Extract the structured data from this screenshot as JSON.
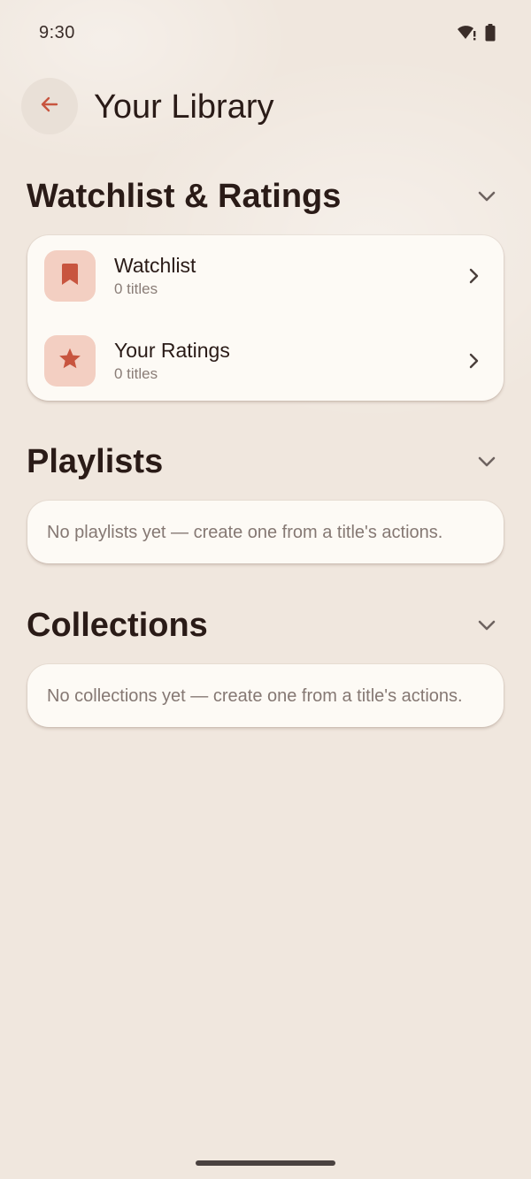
{
  "status_bar": {
    "time": "9:30",
    "icons": [
      "wifi-alert-icon",
      "battery-icon"
    ]
  },
  "header": {
    "back_icon": "arrow-left-icon",
    "title": "Your Library"
  },
  "colors": {
    "accent": "#c8553f",
    "icon_tile": "#f3cfc2",
    "background": "#f0e7de",
    "card": "#fdfaf5",
    "title_text": "#2a1b17",
    "muted_text": "#8a7d77"
  },
  "sections": {
    "watchlist_ratings": {
      "title": "Watchlist & Ratings",
      "items": [
        {
          "icon": "bookmark-icon",
          "title": "Watchlist",
          "subtitle": "0 titles"
        },
        {
          "icon": "star-icon",
          "title": "Your Ratings",
          "subtitle": "0 titles"
        }
      ]
    },
    "playlists": {
      "title": "Playlists",
      "empty_message": "No playlists yet — create one from a title's actions."
    },
    "collections": {
      "title": "Collections",
      "empty_message": "No collections yet — create one from a title's actions."
    }
  }
}
